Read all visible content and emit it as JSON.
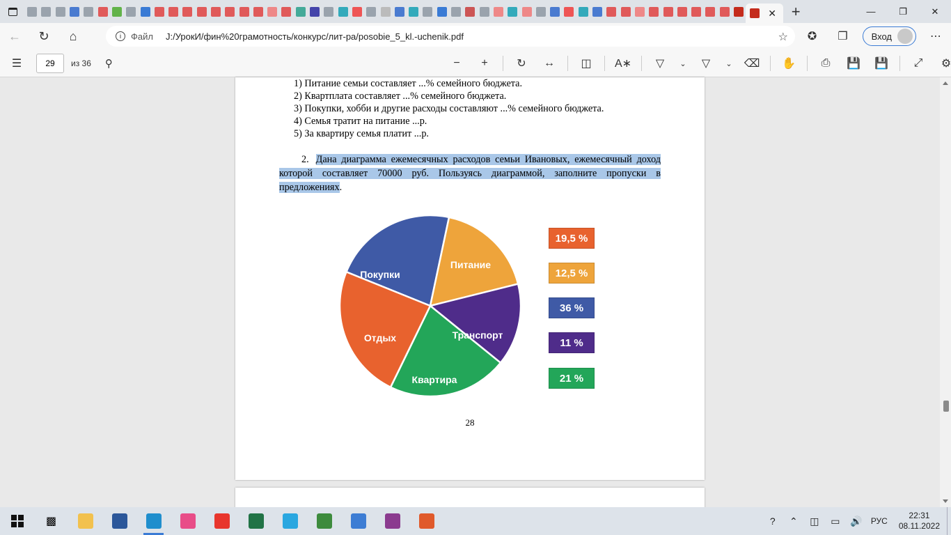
{
  "browser": {
    "active_tab_close": "✕",
    "new_tab": "+",
    "window_controls": {
      "minimize": "—",
      "restore": "❐",
      "close": "✕"
    },
    "address": {
      "scheme": "Файл",
      "url": "J:/УрокИ/фин%20грамотность/конкурс/лит-ра/posobie_5_kl.-uchenik.pdf"
    },
    "signin_label": "Вход"
  },
  "pdf_toolbar": {
    "page_number": "29",
    "page_count": "из 36"
  },
  "document": {
    "lines": [
      "1) Питание семьи составляет ...% семейного бюджета.",
      "2) Квартплата составляет ...% семейного бюджета.",
      "3) Покупки, хобби и другие расходы составляют ...% семейного бюджета.",
      "4) Семья тратит на питание ...р.",
      "5) За квартиру семья платит ...р."
    ],
    "task_number": "2.",
    "task_text": "Дана диаграмма ежемесячных расходов семьи Ивановых, ежемесячный доход которой составляет 70000 руб. Пользуясь диаграммой, заполните пропуски в предложениях",
    "task_end": ".",
    "page_footer": "28"
  },
  "chart_data": {
    "type": "pie",
    "title": "",
    "slices": [
      {
        "label": "Питание",
        "color": "#3f5aa6"
      },
      {
        "label": "Транспорт",
        "color": "#eea43b"
      },
      {
        "label": "Квартира",
        "color": "#4f2c8a"
      },
      {
        "label": "Отдых",
        "color": "#23a659"
      },
      {
        "label": "Покупки",
        "color": "#e8622e"
      }
    ],
    "legend_boxes": [
      {
        "value": "19,5 %",
        "color": "#e8622e"
      },
      {
        "value": "12,5 %",
        "color": "#eea43b"
      },
      {
        "value": "36 %",
        "color": "#3f5aa6"
      },
      {
        "value": "11 %",
        "color": "#4f2c8a"
      },
      {
        "value": "21 %",
        "color": "#23a659"
      }
    ]
  },
  "taskbar": {
    "language": "РУС",
    "time": "22:31",
    "date": "08.11.2022"
  }
}
